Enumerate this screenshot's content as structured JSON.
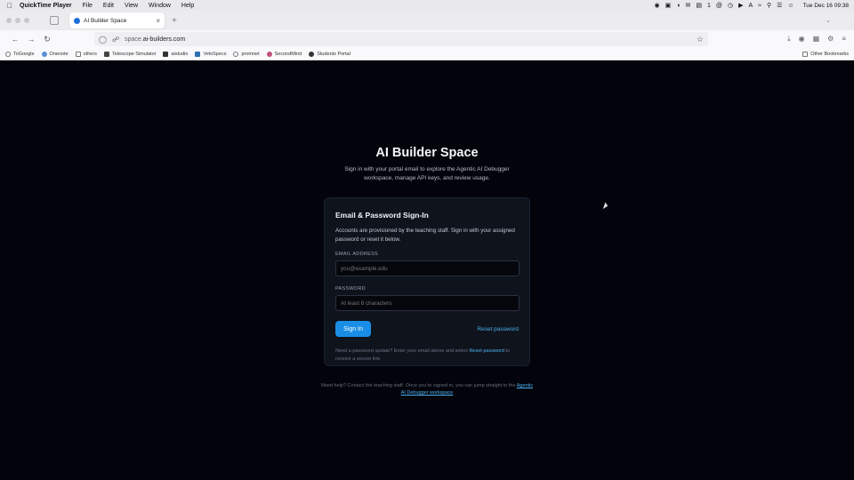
{
  "menubar": {
    "app_name": "QuickTime Player",
    "items": [
      "File",
      "Edit",
      "View",
      "Window",
      "Help"
    ],
    "clock": "Tue Dec 16  09:38",
    "input_source": "A",
    "notification_count": "1"
  },
  "browser": {
    "tab_title": "AI Builder Space",
    "url_prefix": "space.",
    "url_domain": "ai-builders.com",
    "bookmarks": [
      "ToGoogle",
      "Onenote",
      "others",
      "Telescope Simulator",
      "aistudio",
      "VeloSpecs",
      "promnet",
      "SecondMind",
      "Students Portal"
    ],
    "other_bookmarks": "Other Bookmarks"
  },
  "page": {
    "title": "AI Builder Space",
    "subtitle": "Sign in with your portal email to explore the Agentic AI Debugger workspace, manage API keys, and review usage.",
    "card": {
      "title": "Email & Password Sign-In",
      "description": "Accounts are provisioned by the teaching staff. Sign in with your assigned password or reset it below.",
      "email_label": "EMAIL ADDRESS",
      "email_placeholder": "you@example.edu",
      "password_label": "PASSWORD",
      "password_placeholder": "At least 8 characters",
      "signin_label": "Sign In",
      "reset_label": "Reset password",
      "help_prefix": "Need a password update? Enter your email above and select",
      "help_link": "Reset password",
      "help_suffix": "to receive a secure link."
    },
    "footer": {
      "text": "Need help? Contact the teaching staff. Once you're signed in, you can jump straight to the",
      "link": "Agentic AI Debugger workspace"
    }
  },
  "colors": {
    "background": "#02030b",
    "card": "#0e131c",
    "accent": "#1a8ee6",
    "link": "#4eb0f0"
  }
}
